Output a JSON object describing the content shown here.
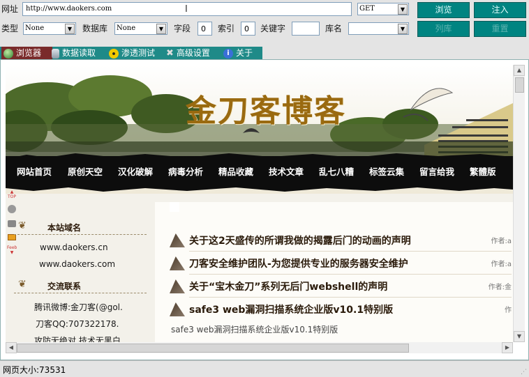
{
  "toolbar": {
    "url_label": "网址",
    "url_value": "http://www.daokers.com",
    "method": "GET",
    "browse_btn": "浏览",
    "inject_btn": "注入",
    "type_label": "类型",
    "type_value": "None",
    "db_label": "数据库",
    "db_value": "None",
    "field_label": "字段",
    "field_value": "0",
    "index_label": "索引",
    "index_value": "0",
    "keyword_label": "关键字",
    "keyword_value": "",
    "dbname_label": "库名",
    "dbname_value": "",
    "list_btn": "列库",
    "reset_btn": "重置"
  },
  "tabs": [
    {
      "label": "浏览器",
      "icon": "globe-icon",
      "color": "#2e9e2e"
    },
    {
      "label": "数据读取",
      "icon": "database-icon",
      "color": "#9aa7b3"
    },
    {
      "label": "渗透测试",
      "icon": "radiation-icon",
      "color": "#e6c200"
    },
    {
      "label": "高级设置",
      "icon": "tools-icon",
      "color": "#c0c0c0"
    },
    {
      "label": "关于",
      "icon": "info-icon",
      "color": "#3a6fd8"
    }
  ],
  "page": {
    "logo_text": "金刀客博客",
    "nav": [
      "网站首页",
      "原创天空",
      "汉化破解",
      "病毒分析",
      "精品收藏",
      "技术文章",
      "乱七八糟",
      "标签云集",
      "留言给我",
      "繁體版"
    ],
    "side_float": [
      "TOP",
      "Feeb"
    ],
    "domain_title": "本站域名",
    "domains": [
      "www.daokers.cn",
      "www.daokers.com"
    ],
    "contact_title": "交流联系",
    "contacts": [
      "腾讯微博:金刀客(@gol.",
      "刀客QQ:707322178.",
      "攻防无绝对,技术无黑白."
    ],
    "posts": [
      {
        "title": "关于这2天盛传的所谓我做的揭露后门的动画的声明",
        "author": "作者:a"
      },
      {
        "title": "刀客安全维护团队-为您提供专业的服务器安全维护",
        "author": "作者:a"
      },
      {
        "title": "关于“宝木金刀”系列无后门webshell的声明",
        "author": "作者:金"
      },
      {
        "title": "safe3 web漏洞扫描系统企业版v10.1特别版",
        "author": "作"
      }
    ],
    "post_excerpt": "safe3 web漏洞扫描系统企业版v10.1特别版"
  },
  "status": {
    "page_size": "网页大小:73531"
  },
  "colors": {
    "accent": "#008481",
    "tab_bar": "#1f8a88",
    "nav_bg": "#0d0d0d",
    "logo": "#9a6a10"
  }
}
